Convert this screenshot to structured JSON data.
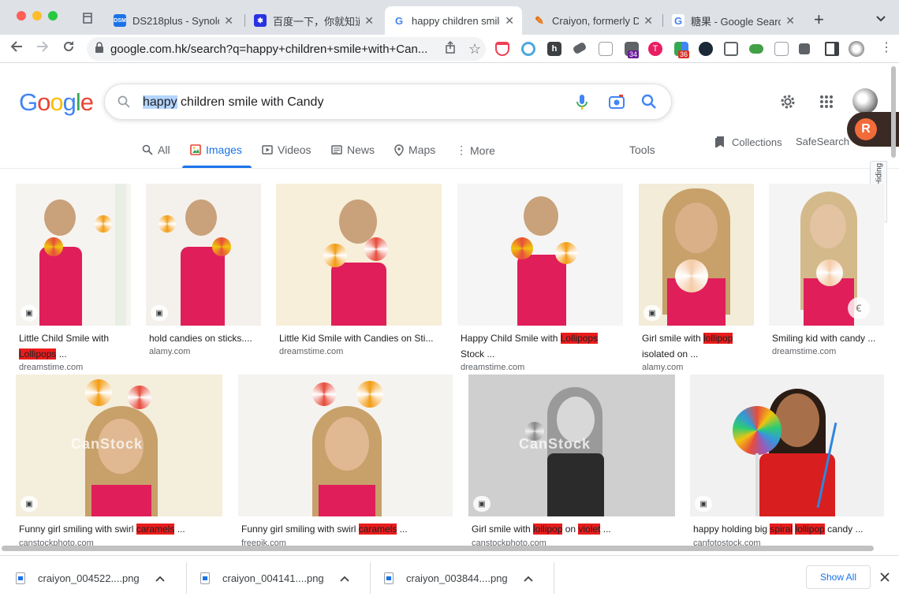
{
  "tabs": [
    {
      "title": "",
      "favicon": "bookmark-icon"
    },
    {
      "title": "DS218plus - Synolo",
      "favicon": "DSM",
      "color": "#1a73e8"
    },
    {
      "title": "百度一下，你就知道",
      "favicon": "paw",
      "color": "#2932e1"
    },
    {
      "title": "happy children smile",
      "favicon": "G",
      "color": "#4285f4"
    },
    {
      "title": "Craiyon, formerly DA",
      "favicon": "pencil",
      "color": "#e8710a"
    },
    {
      "title": "糖果 - Google Search",
      "favicon": "G",
      "color": "#4285f4"
    }
  ],
  "browser": {
    "url": "google.com.hk/search?q=happy+children+smile+with+Can...",
    "badge_34": "34",
    "badge_36": "36",
    "new_tab": "+"
  },
  "search": {
    "query_selected": "happy",
    "query_rest": " children smile with Candy"
  },
  "search_tabs": {
    "all": "All",
    "images": "Images",
    "videos": "Videos",
    "news": "News",
    "maps": "Maps",
    "more": "More",
    "tools": "Tools",
    "collections": "Collections",
    "safesearch": "SafeSearch",
    "manage_hiding": "Manage Hiding"
  },
  "results_row1": [
    {
      "t1": "Little Child Smile with",
      "hl": "Lollipops",
      "t2": " ...",
      "src": "dreamstime.com",
      "two_line": true
    },
    {
      "t1": "hold candies on sticks....",
      "hl": "",
      "t2": "",
      "src": "alamy.com",
      "two_line": false
    },
    {
      "t1": "Little Kid Smile with Candies on Sti...",
      "hl": "",
      "t2": "",
      "src": "dreamstime.com",
      "two_line": false
    },
    {
      "t1": "Happy Child Smile with ",
      "hl": "Lollipops",
      "t2": "Stock ...",
      "src": "dreamstime.com",
      "two_line": true
    },
    {
      "t1": "Girl smile with ",
      "hl": "lollipop",
      "t2": "isolated on ...",
      "src": "alamy.com",
      "two_line": true
    },
    {
      "t1": "Smiling kid with candy ...",
      "hl": "",
      "t2": "",
      "src": "dreamstime.com",
      "two_line": false
    }
  ],
  "results_row2": [
    {
      "t1": "Funny girl smiling with swirl ",
      "hl": "caramels",
      "t2": " ...",
      "src": "canstockphoto.com",
      "wm": "CanStock"
    },
    {
      "t1": "Funny girl smiling with swirl ",
      "hl": "caramels",
      "t2": " ...",
      "src": "freepik.com",
      "wm": ""
    },
    {
      "t1": "Girl smile with ",
      "hl": "lollipop",
      "mid": " on ",
      "hl2": "violet",
      "t2": " ...",
      "src": "canstockphoto.com",
      "wm": "CanStock"
    },
    {
      "t1": "happy holding big ",
      "hl": "spiral",
      "mid": " ",
      "hl2": "lollipop",
      "t2": " candy ...",
      "src": "canfotostock.com",
      "wm": ""
    }
  ],
  "downloads": [
    {
      "name": "craiyon_004522....png"
    },
    {
      "name": "craiyon_004141....png"
    },
    {
      "name": "craiyon_003844....png"
    }
  ],
  "show_all": "Show All",
  "colors": {
    "google_blue": "#4285f4",
    "google_red": "#ea4335",
    "google_yellow": "#fbbc05",
    "google_green": "#34a853",
    "highlight": "#ea1c1c",
    "link_blue": "#1a73e8"
  }
}
